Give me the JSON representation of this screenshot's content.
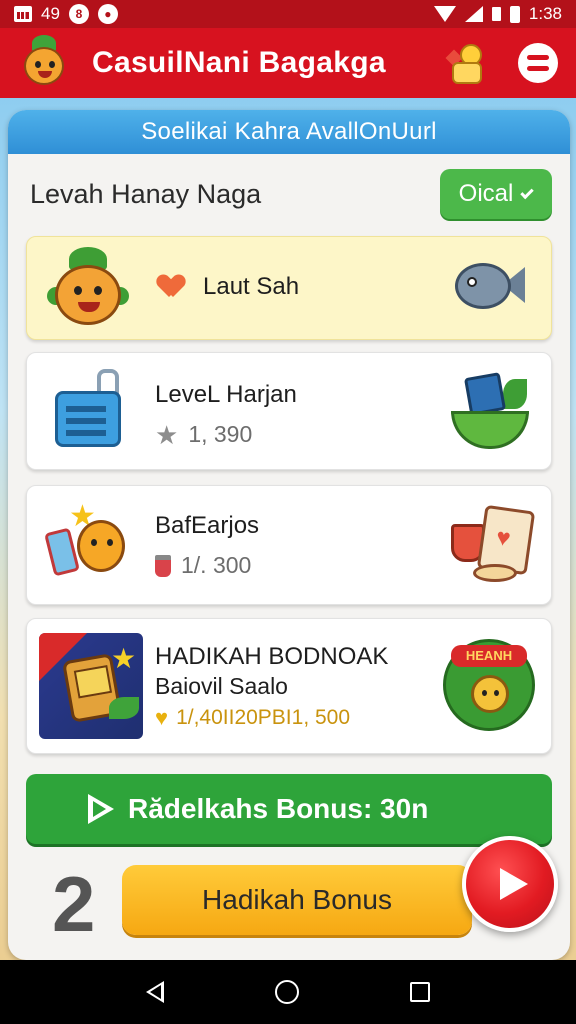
{
  "status": {
    "left_number": "49",
    "badge_symbol": "8",
    "time": "1:38"
  },
  "appbar": {
    "title": "CasuilNani Bagakga"
  },
  "card": {
    "banner": "Soelikai Kahra AvallOnUurl",
    "header_title": "Levah Hanay Naga",
    "ok_label": "Oical"
  },
  "rows": [
    {
      "title": "Laut Sah"
    },
    {
      "title": "LeveL Harjan",
      "sub": "1, 390"
    },
    {
      "title": "BafEarjos",
      "sub": "1/. 300"
    },
    {
      "title": "HADIKAH BODNOAK",
      "subtitle": "Baiovil Saalo",
      "bonus": "1/,40II20PBI1, 500",
      "medal_text": "HEANH"
    }
  ],
  "bonus_bar": {
    "label": "Rădelkahs Bonus: 30n"
  },
  "bottom": {
    "big_number": "2",
    "button_label": "Hadikah Bonus"
  },
  "colors": {
    "appbar": "#d7121f",
    "statusbar": "#b3111a",
    "banner": "#2f8fd6",
    "ok_green": "#4cb84a",
    "bonus_green": "#2ea43a",
    "yellow_button": "#f6a812",
    "fab_red": "#e21b22"
  },
  "icons": {
    "appbar_left": "pineapple-mascot-icon",
    "appbar_right": "gift-coin-icon",
    "menu": "menu-icon",
    "fab": "play-icon"
  }
}
